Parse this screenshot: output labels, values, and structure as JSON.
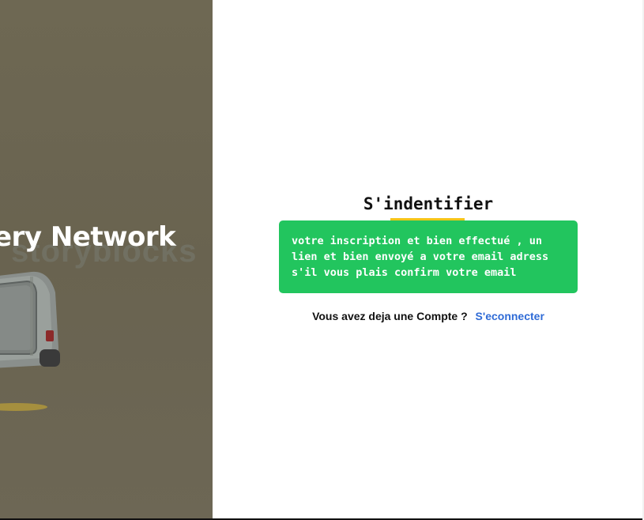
{
  "hero": {
    "title": "ery Network",
    "watermark_text": "storyblocks",
    "background_color": "#6b6552"
  },
  "auth": {
    "title": "S'indentifier",
    "alert_message": "votre inscription et bien effectué , un lien et bien envoyé a votre email adress s'il vous plais confirm votre email",
    "alert_color": "#22c55e",
    "account_prompt": "Vous avez deja une Compte ?",
    "login_link": "S'econnecter",
    "link_color": "#2f6bd6",
    "accent_color": "#f5c518"
  }
}
